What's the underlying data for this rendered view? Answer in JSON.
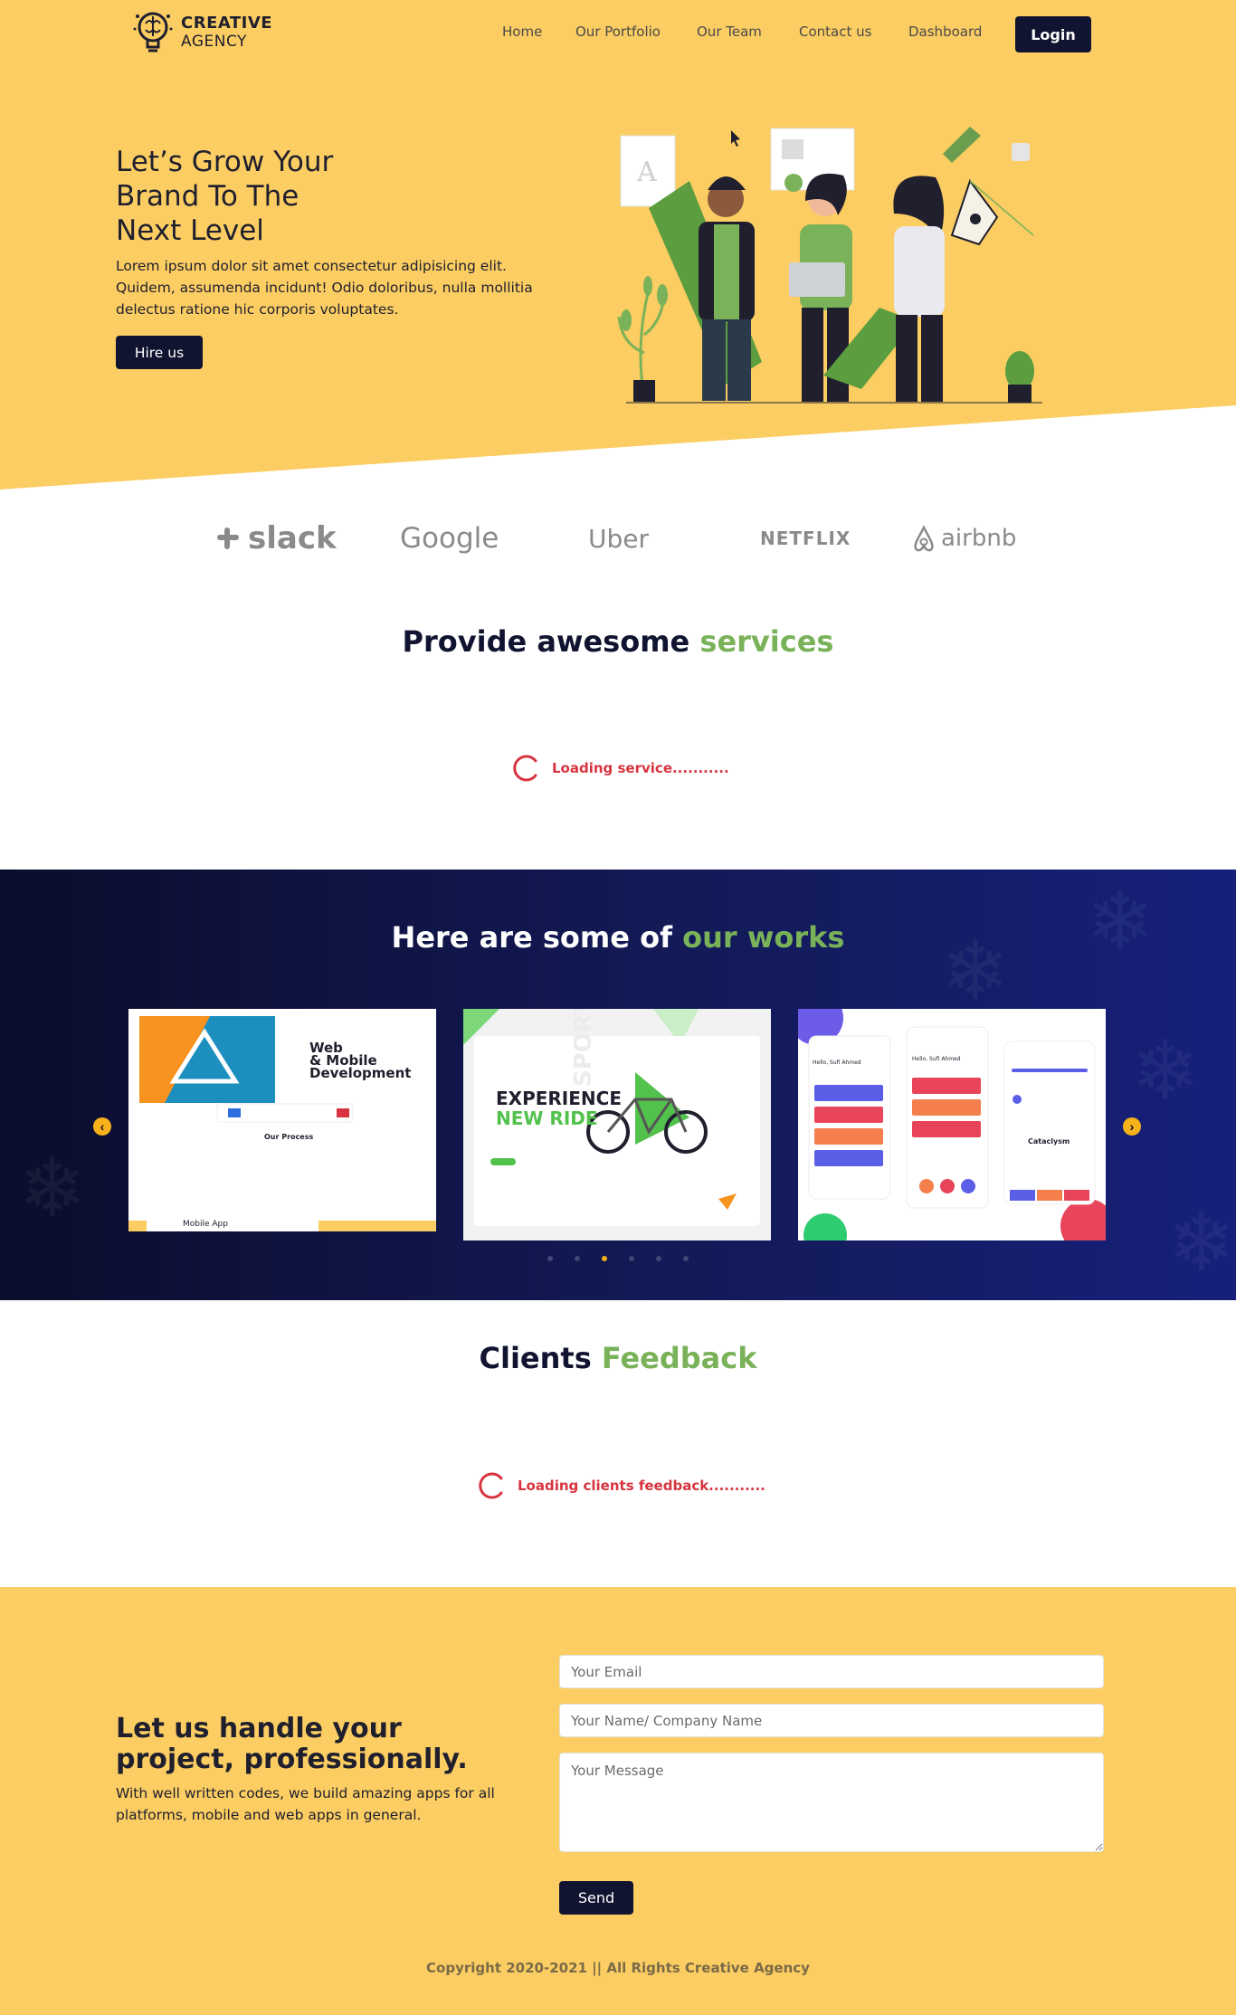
{
  "brand": {
    "line1": "CREATIVE",
    "line2": "AGENCY"
  },
  "nav": {
    "items": [
      "Home",
      "Our Portfolio",
      "Our Team",
      "Contact us",
      "Dashboard"
    ],
    "login_label": "Login"
  },
  "hero": {
    "title_lines": [
      "Let’s Grow Your",
      "Brand To The",
      "Next Level"
    ],
    "description": "Lorem ipsum dolor sit amet consectetur adipisicing elit. Quidem, assumenda incidunt! Odio doloribus, nulla mollitia delectus ratione hic corporis voluptates.",
    "cta_label": "Hire us"
  },
  "clients_logos": [
    "slack",
    "Google",
    "Uber",
    "NETFLIX",
    "airbnb"
  ],
  "services": {
    "title_main": "Provide awesome",
    "title_accent": "services",
    "loading_text": "Loading service..........."
  },
  "works": {
    "title_main": "Here are some of",
    "title_accent": "our works",
    "cards": [
      {
        "heading_lines": [
          "Web",
          "& Mobile",
          "Development"
        ],
        "subheading": "Our Process",
        "footer": "Mobile App"
      },
      {
        "heading_lines": [
          "EXPERIENCE",
          "NEW RIDE"
        ],
        "side_text": "SPORT"
      },
      {
        "labels": [
          "Hello, Sufi Ahmed",
          "Hello, Sufi Ahmed",
          "Cataclysm"
        ]
      }
    ],
    "active_dot": 2,
    "dot_count": 6
  },
  "feedback": {
    "title_main": "Clients",
    "title_accent": "Feedback",
    "loading_text": "Loading clients feedback..........."
  },
  "contact": {
    "title_lines": [
      "Let us handle your",
      "project, professionally."
    ],
    "description": "With well written codes, we build amazing apps for all platforms, mobile and web apps in general.",
    "email_placeholder": "Your Email",
    "name_placeholder": "Your Name/ Company Name",
    "message_placeholder": "Your Message",
    "send_label": "Send"
  },
  "footer": {
    "copyright": "Copyright 2020-2021 || All Rights Creative Agency"
  },
  "colors": {
    "yellow": "#fbcd62",
    "navy": "#111430",
    "green_accent": "#7ab259",
    "red_loading": "#d7343f",
    "orange_arrow": "#f7b11b"
  }
}
